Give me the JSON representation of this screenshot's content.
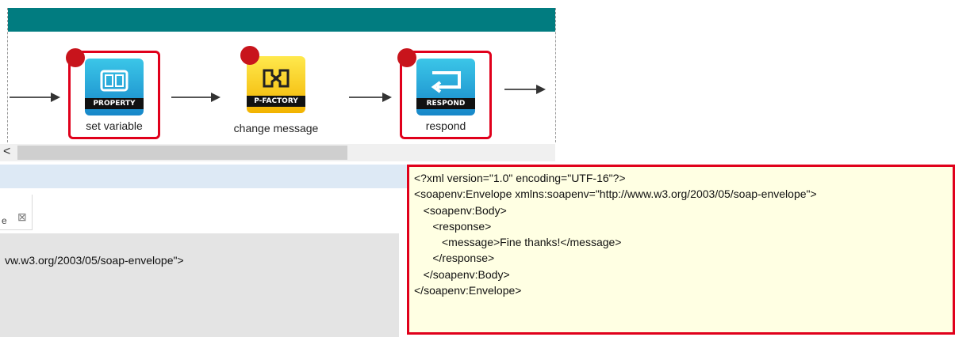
{
  "flow": {
    "nodes": [
      {
        "icon_label": "PROPERTY",
        "caption": "set variable",
        "selected": true,
        "icon": "property-icon"
      },
      {
        "icon_label": "P-FACTORY",
        "caption": "change message",
        "selected": false,
        "icon": "p-factory-icon"
      },
      {
        "icon_label": "RESPOND",
        "caption": "respond",
        "selected": true,
        "icon": "respond-icon"
      }
    ],
    "scroll_left_glyph": "<"
  },
  "panel": {
    "tab_text": "e",
    "close_glyph": "⊠",
    "text": "vw.w3.org/2003/05/soap-envelope\">"
  },
  "tooltip": {
    "lines": [
      "<?xml version=\"1.0\" encoding=\"UTF-16\"?>",
      "<soapenv:Envelope xmlns:soapenv=\"http://www.w3.org/2003/05/soap-envelope\">",
      "   <soapenv:Body>",
      "      <response>",
      "         <message>Fine thanks!</message>",
      "      </response>",
      "   </soapenv:Body>",
      "</soapenv:Envelope>"
    ]
  },
  "colors": {
    "header_teal": "#017c80",
    "selection_red": "#e0001b",
    "tooltip_bg": "#ffffe3"
  }
}
